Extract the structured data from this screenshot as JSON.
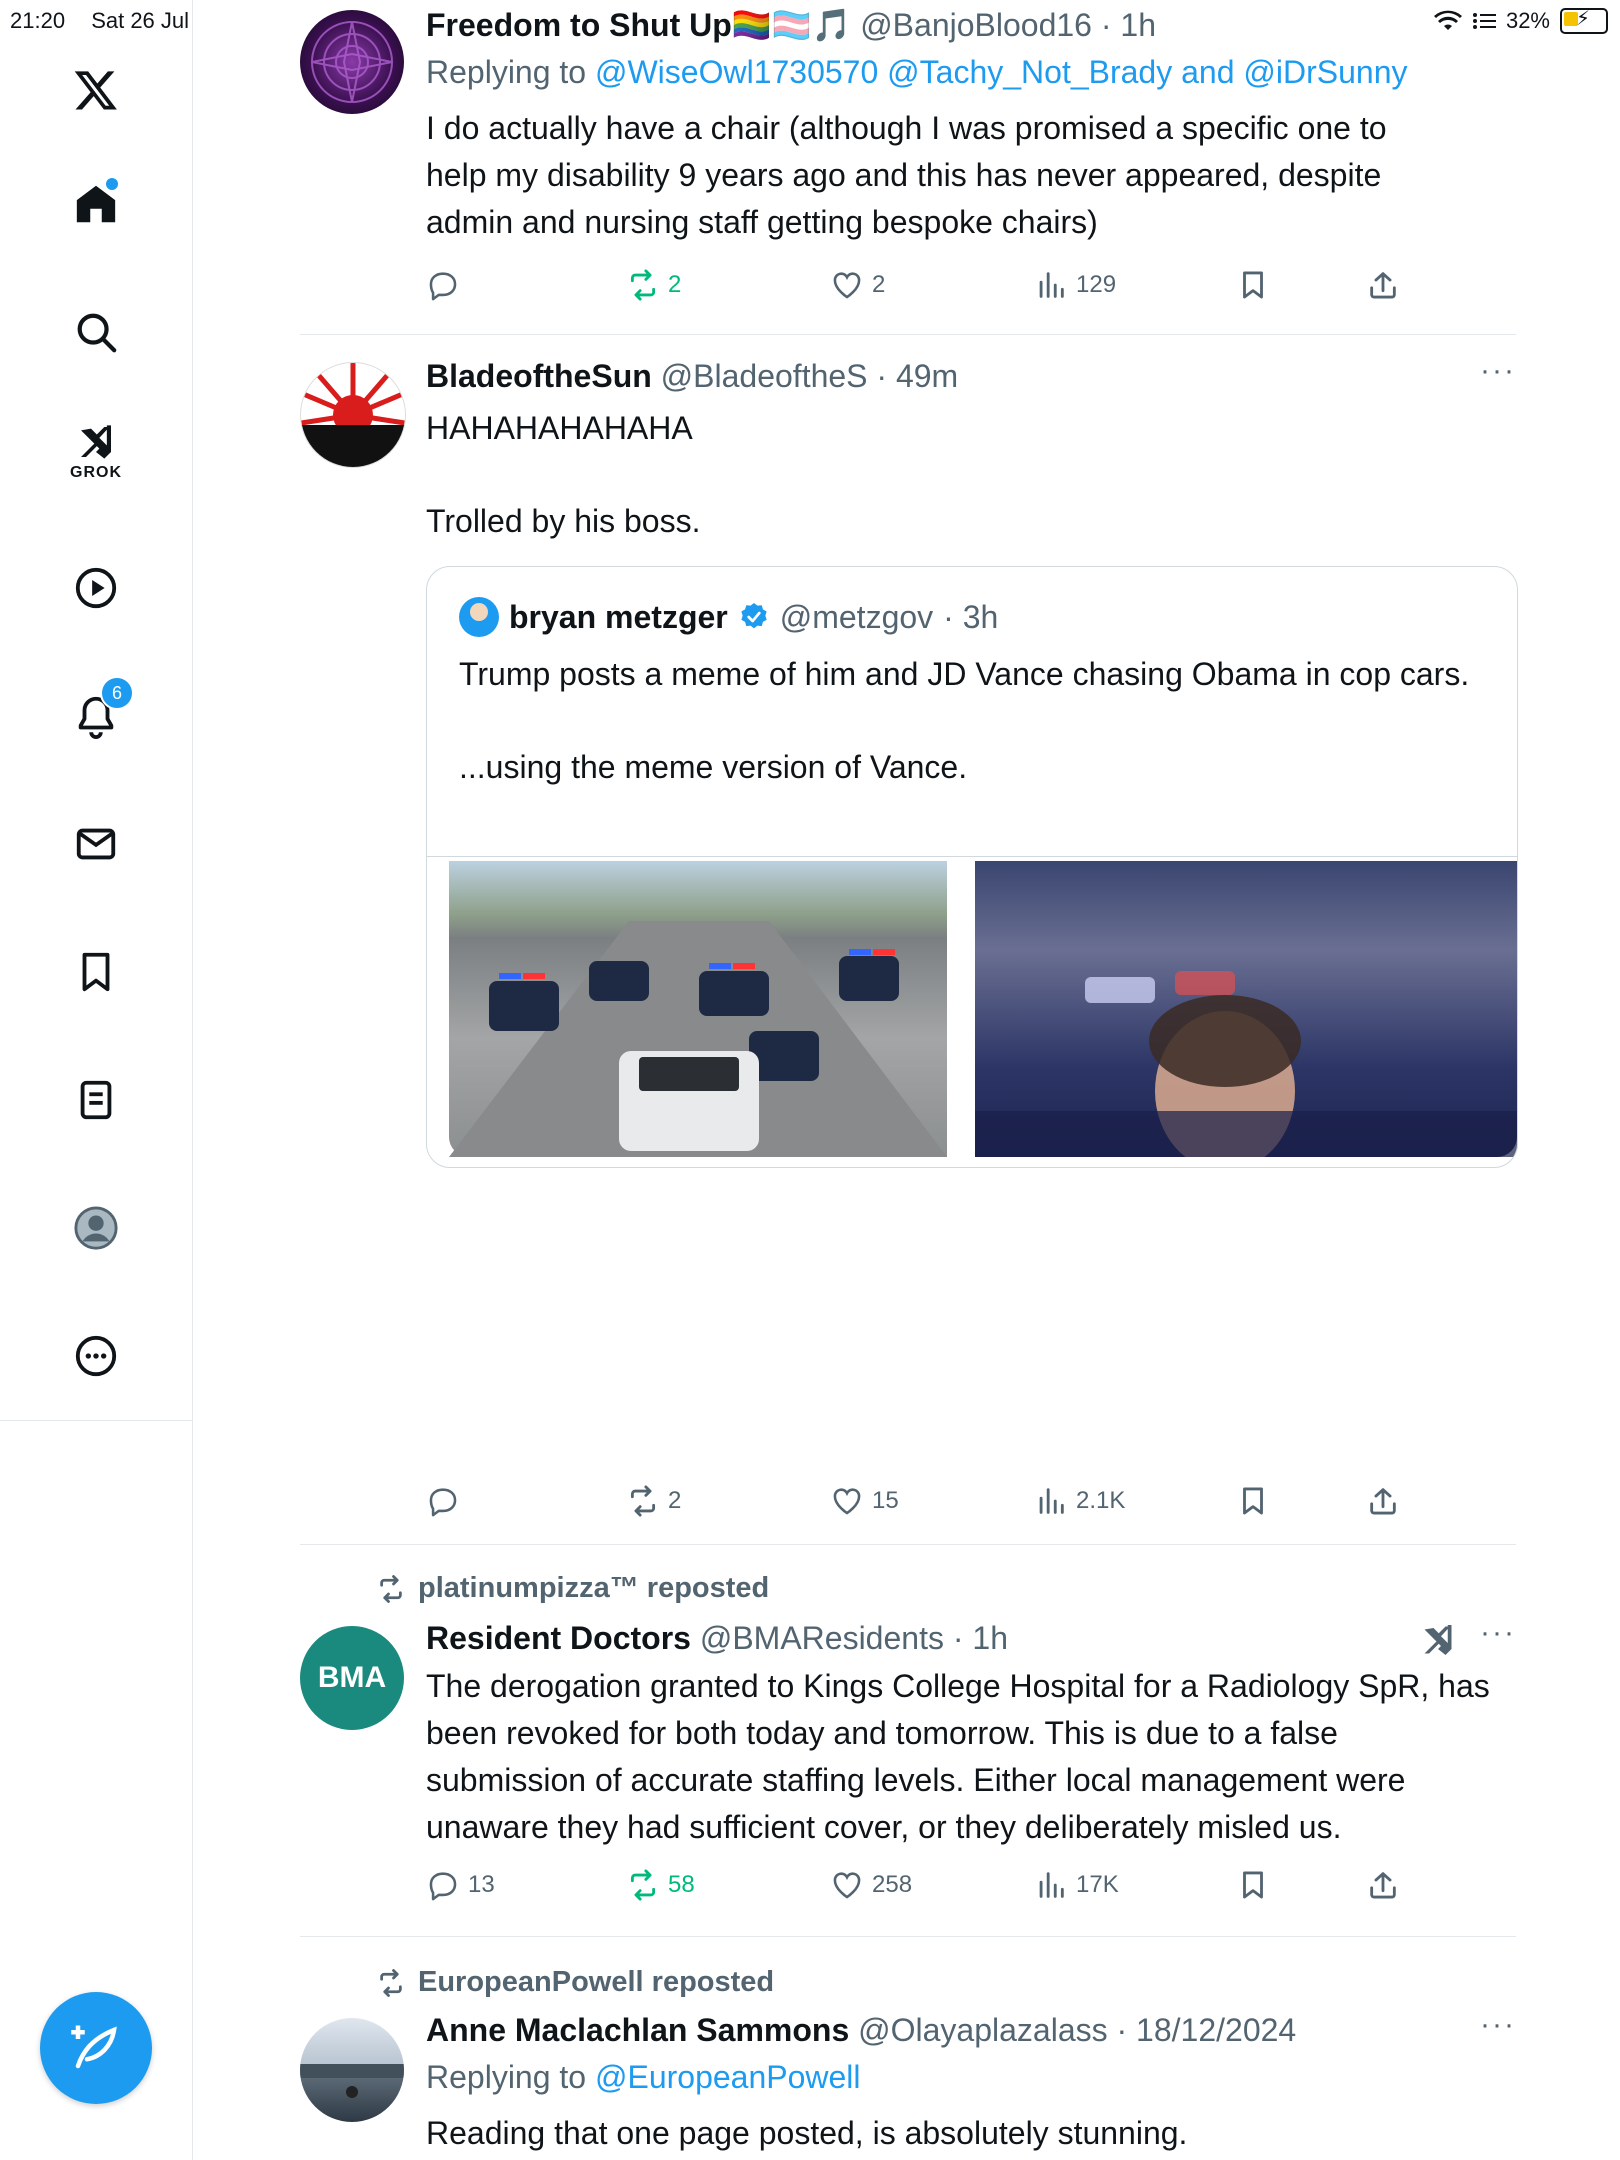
{
  "status_bar": {
    "time": "21:20",
    "date": "Sat 26 Jul",
    "battery": "32%"
  },
  "sidebar": {
    "notifications_count": "6",
    "grok_label": "GROK"
  },
  "tweets": [
    {
      "name": "Freedom to Shut Up🏳️‍🌈🏳️‍⚧️🎵",
      "handle": "@BanjoBlood16",
      "time": "· 1h",
      "replying_prefix": "Replying to",
      "replying_to": "@WiseOwl1730570 @Tachy_Not_Brady and @iDrSunny",
      "text": "I do actually have a chair (although I was promised a specific one to help my disability 9 years ago and this has never appeared, despite admin and nursing staff getting bespoke chairs)",
      "replies": "",
      "reposts": "2",
      "likes": "2",
      "views": "129"
    },
    {
      "name": "BladeoftheSun",
      "handle": "@BladeoftheS",
      "time": "· 49m",
      "text_line1": "HAHAHAHAHAHA",
      "text_line2": "Trolled by his boss.",
      "quote": {
        "name": "bryan metzger",
        "handle": "@metzgov",
        "time": "· 3h",
        "text_line1": "Trump posts a meme of him and JD Vance chasing Obama in cop cars.",
        "text_line2": "...using the meme version of Vance."
      },
      "replies": "",
      "reposts": "2",
      "likes": "15",
      "views": "2.1K"
    },
    {
      "reposted_by": "platinumpizza™ reposted",
      "name": "Resident Doctors",
      "handle": "@BMAResidents",
      "time": "· 1h",
      "avatar_text": "BMA",
      "text": "The derogation granted to Kings College Hospital for a Radiology SpR, has been revoked for both today and tomorrow. This is due to a false submission of accurate staffing levels. Either local management were unaware they had sufficient cover, or they deliberately misled us.",
      "replies": "13",
      "reposts": "58",
      "likes": "258",
      "views": "17K"
    },
    {
      "reposted_by": "EuropeanPowell reposted",
      "name": "Anne Maclachlan Sammons",
      "handle": "@Olayaplazalass",
      "time": "· 18/12/2024",
      "replying_prefix": "Replying to",
      "replying_to": "@EuropeanPowell",
      "text": "Reading that one page posted, is absolutely stunning."
    }
  ],
  "colors": {
    "accent": "#1d9bf0",
    "repost_green": "#00ba7c",
    "muted": "#536471",
    "bma_teal": "#1a8a7e"
  }
}
